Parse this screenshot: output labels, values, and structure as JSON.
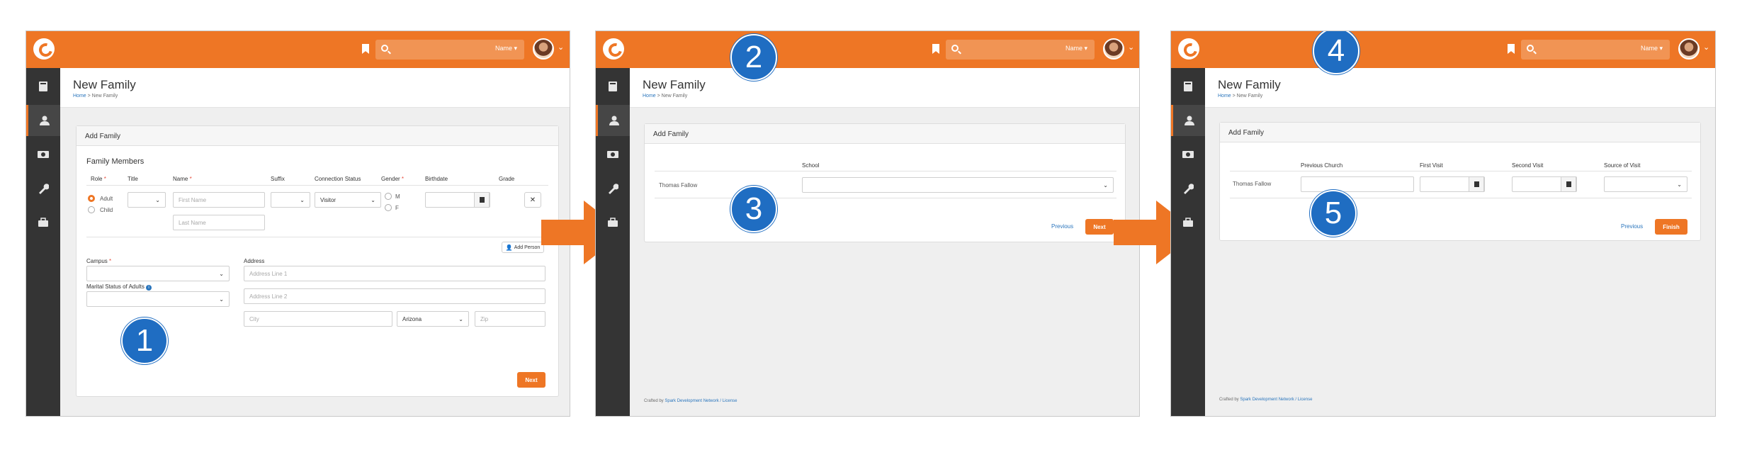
{
  "common": {
    "page_title": "New Family",
    "breadcrumb_home": "Home",
    "breadcrumb_sep": " > ",
    "breadcrumb_current": "New Family",
    "panel_title": "Add Family",
    "search_select": "Name ▾",
    "footer_prefix": "Crafted by ",
    "footer_link": "Spark Development Network / License",
    "accent_color": "#ee7625",
    "sidebar_icons": [
      "book-icon",
      "person-icon",
      "money-icon",
      "wrench-icon",
      "briefcase-icon"
    ]
  },
  "step1": {
    "badge": "1",
    "section_title": "Family Members",
    "columns": {
      "role": "Role",
      "title": "Title",
      "name": "Name",
      "suffix": "Suffix",
      "connection_status": "Connection Status",
      "gender": "Gender",
      "birthdate": "Birthdate",
      "grade": "Grade"
    },
    "required_mark": "*",
    "role_adult": "Adult",
    "role_child": "Child",
    "first_name_placeholder": "First Name",
    "last_name_placeholder": "Last Name",
    "connection_status_value": "Visitor",
    "gender_m": "M",
    "gender_f": "F",
    "remove_button": "✕",
    "add_person_button": "Add Person",
    "campus_label": "Campus",
    "address_label": "Address",
    "address_line1_placeholder": "Address Line 1",
    "address_line2_placeholder": "Address Line 2",
    "marital_status_label": "Marital Status of Adults",
    "city_placeholder": "City",
    "state_value": "Arizona",
    "zip_placeholder": "Zip",
    "next_button": "Next"
  },
  "step2": {
    "badge_top": "2",
    "badge_mid": "3",
    "school_label": "School",
    "person_name": "Thomas Fallow",
    "previous_link": "Previous",
    "next_button": "Next"
  },
  "step3": {
    "badge_top": "4",
    "badge_mid": "5",
    "columns": {
      "previous_church": "Previous Church",
      "first_visit": "First Visit",
      "second_visit": "Second Visit",
      "source_of_visit": "Source of Visit"
    },
    "person_name": "Thomas Fallow",
    "previous_link": "Previous",
    "finish_button": "Finish"
  }
}
